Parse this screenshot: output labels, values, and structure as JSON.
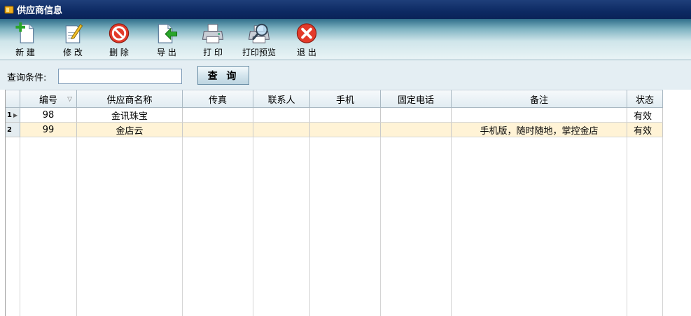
{
  "window": {
    "title": "供应商信息"
  },
  "toolbar": {
    "buttons": [
      {
        "id": "new",
        "label": "新 建",
        "icon": "new-doc-icon"
      },
      {
        "id": "edit",
        "label": "修 改",
        "icon": "edit-pencil-icon"
      },
      {
        "id": "delete",
        "label": "删 除",
        "icon": "delete-icon"
      },
      {
        "id": "export",
        "label": "导 出",
        "icon": "export-icon"
      },
      {
        "id": "print",
        "label": "打 印",
        "icon": "printer-icon"
      },
      {
        "id": "preview",
        "label": "打印预览",
        "icon": "print-preview-icon"
      },
      {
        "id": "exit",
        "label": "退 出",
        "icon": "exit-icon"
      }
    ]
  },
  "query": {
    "label": "查询条件:",
    "value": "",
    "button_label": "查 询"
  },
  "table": {
    "columns": [
      "编号",
      "供应商名称",
      "传真",
      "联系人",
      "手机",
      "固定电话",
      "备注",
      "状态"
    ],
    "rows": [
      {
        "num": "1",
        "cells": [
          "98",
          "金讯珠宝",
          "",
          "",
          "",
          "",
          "",
          "有效"
        ]
      },
      {
        "num": "2",
        "cells": [
          "99",
          "金店云",
          "",
          "",
          "",
          "",
          "手机版，随时随地，掌控金店",
          "有效"
        ]
      }
    ]
  },
  "colors": {
    "title_bg": "#0d2a63",
    "selected_row": "#fff3d6",
    "header_bg": "#e1ecf2"
  }
}
